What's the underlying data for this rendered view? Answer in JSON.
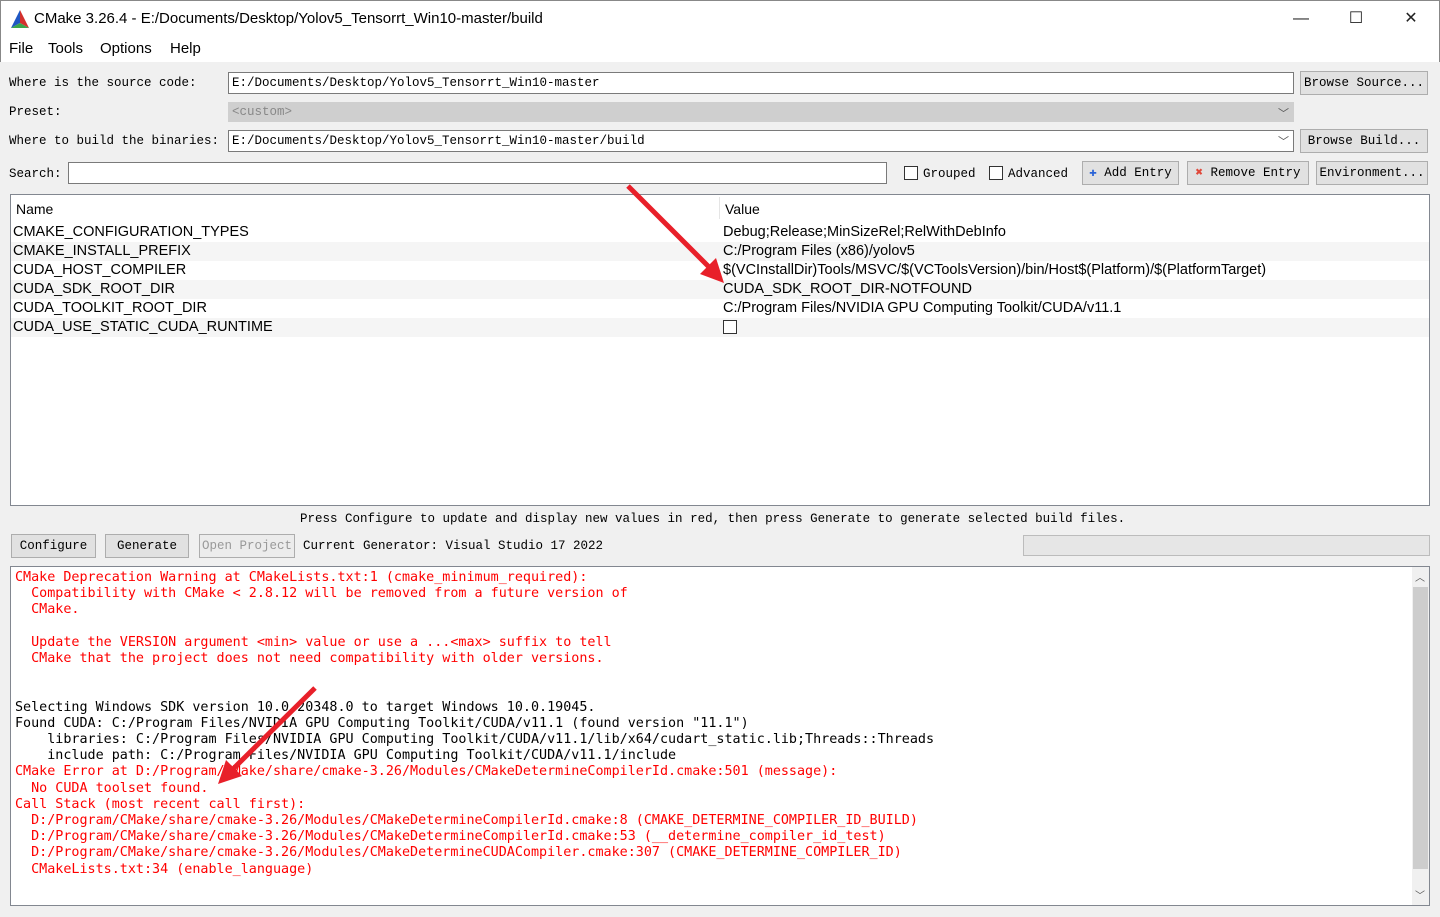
{
  "window": {
    "title": "CMake 3.26.4 - E:/Documents/Desktop/Yolov5_Tensorrt_Win10-master/build",
    "minimize": "—",
    "maximize": "☐",
    "close": "✕"
  },
  "menu": [
    "File",
    "Tools",
    "Options",
    "Help"
  ],
  "source": {
    "label": "Where is the source code:",
    "value": "E:/Documents/Desktop/Yolov5_Tensorrt_Win10-master",
    "browse": "Browse Source..."
  },
  "preset": {
    "label": "Preset:",
    "value": "<custom>"
  },
  "build": {
    "label": "Where to build the binaries:",
    "value": "E:/Documents/Desktop/Yolov5_Tensorrt_Win10-master/build",
    "browse": "Browse Build..."
  },
  "search": {
    "label": "Search:",
    "value": ""
  },
  "options": {
    "grouped": "Grouped",
    "advanced": "Advanced",
    "grouped_checked": false,
    "advanced_checked": false,
    "add": "Add Entry",
    "remove": "Remove Entry",
    "environment": "Environment..."
  },
  "table": {
    "headers": [
      "Name",
      "Value"
    ],
    "rows": [
      {
        "name": "CMAKE_CONFIGURATION_TYPES",
        "value": "Debug;Release;MinSizeRel;RelWithDebInfo"
      },
      {
        "name": "CMAKE_INSTALL_PREFIX",
        "value": "C:/Program Files (x86)/yolov5"
      },
      {
        "name": "CUDA_HOST_COMPILER",
        "value": "$(VCInstallDir)Tools/MSVC/$(VCToolsVersion)/bin/Host$(Platform)/$(PlatformTarget)"
      },
      {
        "name": "CUDA_SDK_ROOT_DIR",
        "value": "CUDA_SDK_ROOT_DIR-NOTFOUND"
      },
      {
        "name": "CUDA_TOOLKIT_ROOT_DIR",
        "value": "C:/Program Files/NVIDIA GPU Computing Toolkit/CUDA/v11.1"
      },
      {
        "name": "CUDA_USE_STATIC_CUDA_RUNTIME",
        "value": ""
      }
    ]
  },
  "hint": "Press Configure to update and display new values in red, then press Generate to generate selected build files.",
  "actions": {
    "configure": "Configure",
    "generate": "Generate",
    "open_project": "Open Project",
    "generator": "Current Generator: Visual Studio 17 2022"
  },
  "log": [
    {
      "t": "CMake Deprecation Warning at CMakeLists.txt:1 (cmake_minimum_required):",
      "c": "red"
    },
    {
      "t": "  Compatibility with CMake < 2.8.12 will be removed from a future version of",
      "c": "red"
    },
    {
      "t": "  CMake.",
      "c": "red"
    },
    {
      "t": "",
      "c": "red"
    },
    {
      "t": "  Update the VERSION argument <min> value or use a ...<max> suffix to tell",
      "c": "red"
    },
    {
      "t": "  CMake that the project does not need compatibility with older versions.",
      "c": "red"
    },
    {
      "t": "",
      "c": "red"
    },
    {
      "t": "",
      "c": "red"
    },
    {
      "t": "Selecting Windows SDK version 10.0.20348.0 to target Windows 10.0.19045.",
      "c": "blk"
    },
    {
      "t": "Found CUDA: C:/Program Files/NVIDIA GPU Computing Toolkit/CUDA/v11.1 (found version \"11.1\")",
      "c": "blk"
    },
    {
      "t": "    libraries: C:/Program Files/NVIDIA GPU Computing Toolkit/CUDA/v11.1/lib/x64/cudart_static.lib;Threads::Threads",
      "c": "blk"
    },
    {
      "t": "    include path: C:/Program Files/NVIDIA GPU Computing Toolkit/CUDA/v11.1/include",
      "c": "blk"
    },
    {
      "t": "CMake Error at D:/Program/CMake/share/cmake-3.26/Modules/CMakeDetermineCompilerId.cmake:501 (message):",
      "c": "red"
    },
    {
      "t": "  No CUDA toolset found.",
      "c": "red"
    },
    {
      "t": "Call Stack (most recent call first):",
      "c": "red"
    },
    {
      "t": "  D:/Program/CMake/share/cmake-3.26/Modules/CMakeDetermineCompilerId.cmake:8 (CMAKE_DETERMINE_COMPILER_ID_BUILD)",
      "c": "red"
    },
    {
      "t": "  D:/Program/CMake/share/cmake-3.26/Modules/CMakeDetermineCompilerId.cmake:53 (__determine_compiler_id_test)",
      "c": "red"
    },
    {
      "t": "  D:/Program/CMake/share/cmake-3.26/Modules/CMakeDetermineCUDACompiler.cmake:307 (CMAKE_DETERMINE_COMPILER_ID)",
      "c": "red"
    },
    {
      "t": "  CMakeLists.txt:34 (enable_language)",
      "c": "red"
    }
  ],
  "colors": {
    "error": "#ff0000",
    "annotation_arrow": "#e8202a"
  }
}
